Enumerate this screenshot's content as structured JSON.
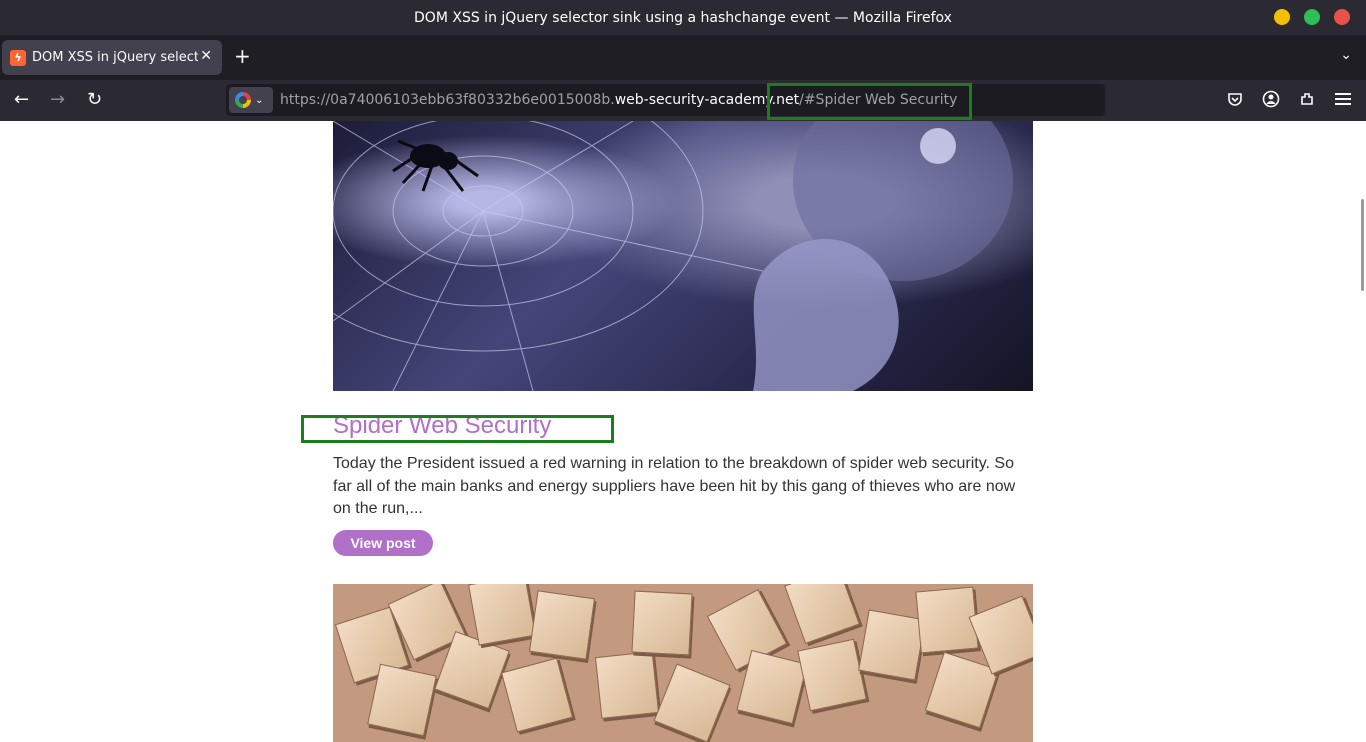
{
  "window": {
    "title": "DOM XSS in jQuery selector sink using a hashchange event — Mozilla Firefox",
    "controls": {
      "minimize_color": "#f6c000",
      "maximize_color": "#2fbe55",
      "close_color": "#e9524a"
    }
  },
  "tabs": [
    {
      "label": "DOM XSS in jQuery selector sink using a hashchange event",
      "icon": "portswigger-favicon-icon",
      "active": true
    }
  ],
  "tabstrip": {
    "new_tab_icon": "+",
    "list_icon": "⌄"
  },
  "navbar": {
    "back_icon": "←",
    "forward_icon": "→",
    "reload_icon": "↻",
    "url_prefix": "https://0a74006103ebb63f80332b6e0015008b.",
    "url_host": "web-security-academy.net",
    "url_suffix": "/#Spider Web Security",
    "search_engine": "Google"
  },
  "post": {
    "title": "Spider Web Security",
    "summary": "Today the President issued a red warning in relation to the breakdown of spider web security. So far all of the main banks and energy suppliers have been hit by this gang of thieves who are now on the run,...",
    "button_label": "View post"
  },
  "colors": {
    "accent": "#b070c8",
    "highlight": "#1a7f1a"
  }
}
